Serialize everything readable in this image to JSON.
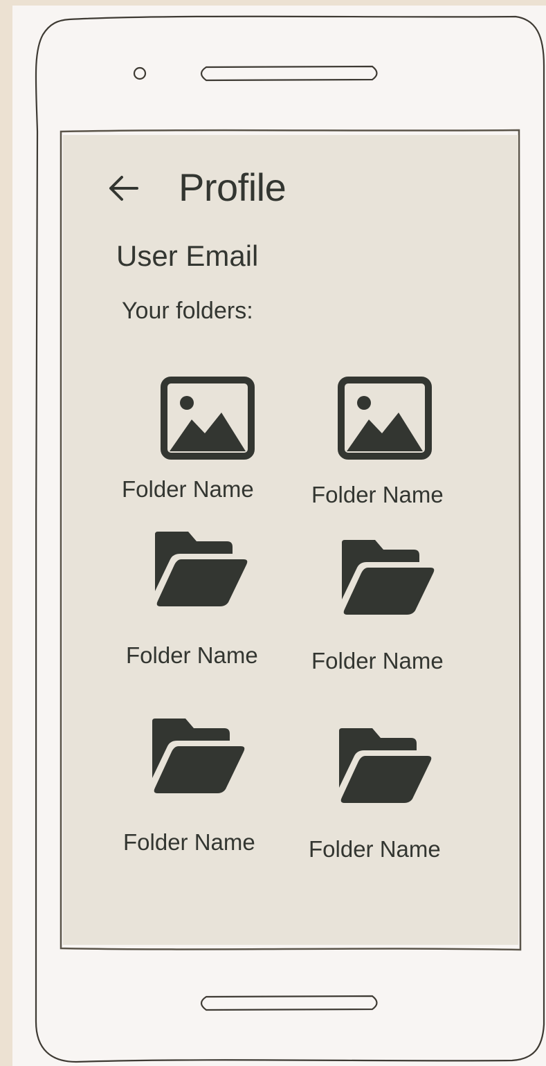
{
  "header": {
    "title": "Profile",
    "back_icon": "arrow-left-icon"
  },
  "profile": {
    "email_label": "User Email",
    "folders_heading": "Your folders:"
  },
  "folders": [
    {
      "label": "Folder Name",
      "icon": "image-icon"
    },
    {
      "label": "Folder Name",
      "icon": "image-icon"
    },
    {
      "label": "Folder Name",
      "icon": "folder-open-icon"
    },
    {
      "label": "Folder Name",
      "icon": "folder-open-icon"
    },
    {
      "label": "Folder Name",
      "icon": "folder-open-icon"
    },
    {
      "label": "Folder Name",
      "icon": "folder-open-icon"
    }
  ],
  "colors": {
    "page_background": "#ece1d2",
    "device_body": "#f8f5f3",
    "screen": "#e8e3d9",
    "ink": "#333631"
  }
}
